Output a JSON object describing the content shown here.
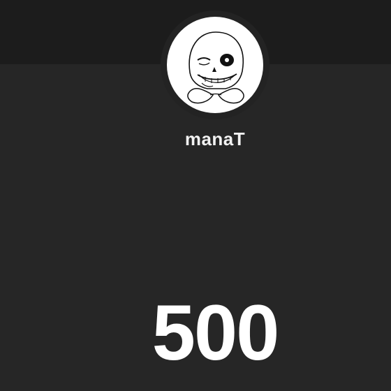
{
  "profile": {
    "username": "manaT",
    "avatar_icon": "sans-skeleton-avatar"
  },
  "counter": {
    "value": "500"
  },
  "colors": {
    "background": "#262626",
    "top_band": "#1c1c1c",
    "text": "#ffffff",
    "avatar_background": "#ffffff"
  }
}
